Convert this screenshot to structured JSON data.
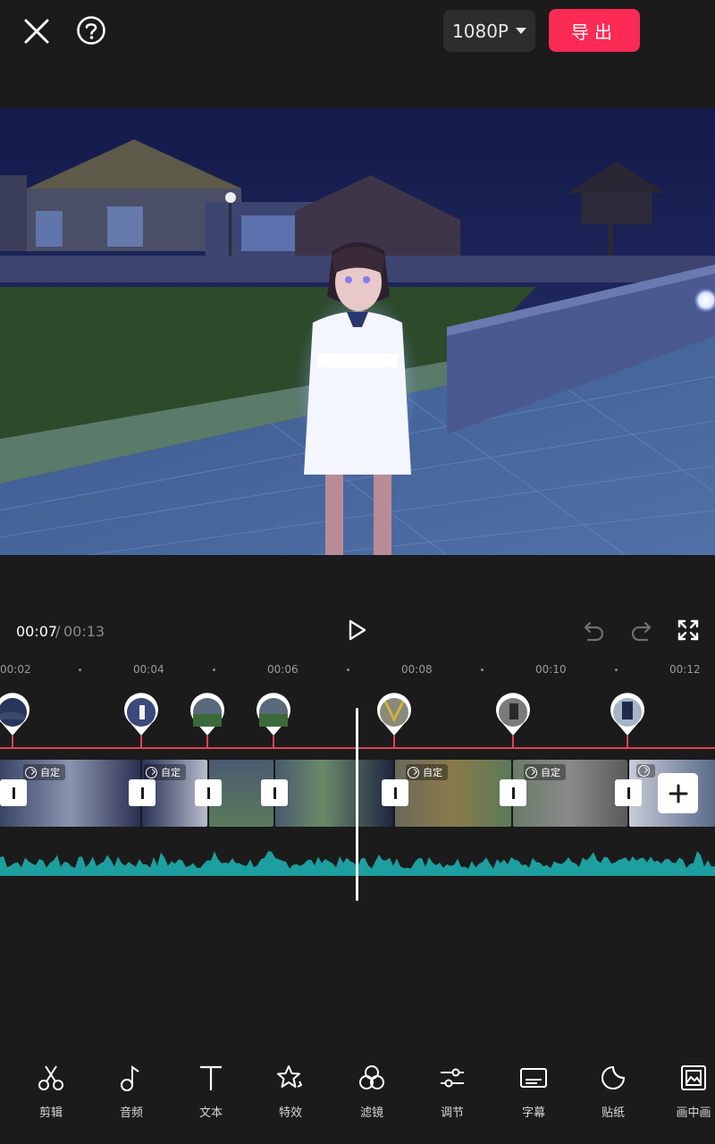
{
  "header": {
    "resolution": "1080P",
    "export_label": "导出"
  },
  "playback": {
    "current_time": "00:07",
    "separator": "/",
    "total_time": "00:13"
  },
  "ruler": {
    "labels": [
      "00:02",
      "00:04",
      "00:06",
      "00:08",
      "00:10",
      "00:12"
    ]
  },
  "clips": {
    "speed_badge": "自定"
  },
  "toolbar": {
    "items": [
      {
        "label": "剪辑",
        "icon": "scissors-icon"
      },
      {
        "label": "音频",
        "icon": "music-note-icon"
      },
      {
        "label": "文本",
        "icon": "text-icon"
      },
      {
        "label": "特效",
        "icon": "effects-star-icon"
      },
      {
        "label": "滤镜",
        "icon": "filter-icon"
      },
      {
        "label": "调节",
        "icon": "adjust-sliders-icon"
      },
      {
        "label": "字幕",
        "icon": "subtitle-icon"
      },
      {
        "label": "贴纸",
        "icon": "sticker-icon"
      },
      {
        "label": "画中画",
        "icon": "picture-in-picture-icon"
      }
    ]
  },
  "colors": {
    "accent": "#fc2b55",
    "audio_wave": "#1d9f9f",
    "marker_line": "#e04352",
    "background": "#1b1b1b"
  }
}
